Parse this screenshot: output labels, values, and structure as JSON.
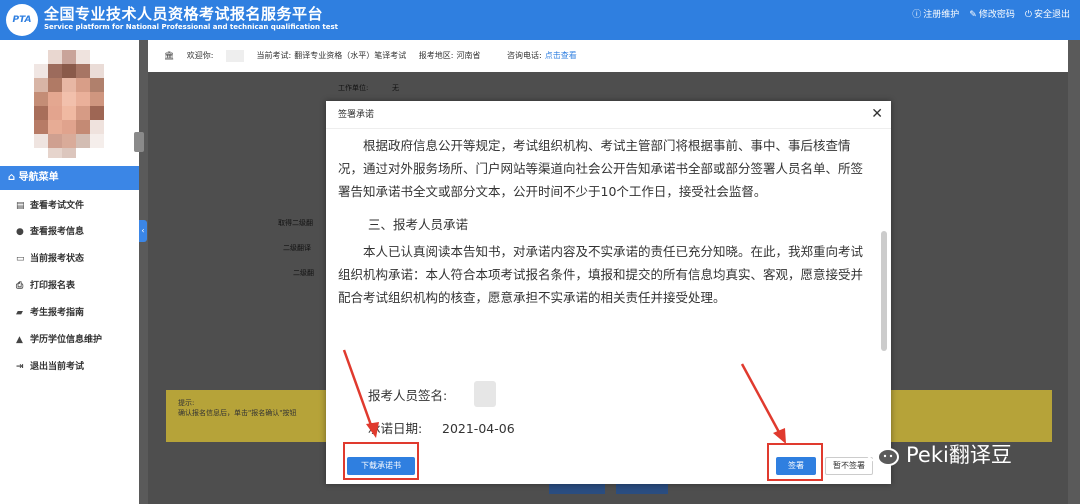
{
  "header": {
    "logo_text": "PTA",
    "title_cn": "全国专业技术人员资格考试报名服务平台",
    "title_en": "Service platform for National Professional and technican qualification test",
    "links": [
      {
        "icon": "info-icon",
        "label": "注册维护"
      },
      {
        "icon": "edit-icon",
        "label": "修改密码"
      },
      {
        "icon": "power-icon",
        "label": "安全退出"
      }
    ]
  },
  "topbar": {
    "welcome": "欢迎你:",
    "current_exam_label": "当前考试:",
    "current_exam": "翻译专业资格（水平）笔译考试",
    "region_label": "报考地区:",
    "region": "河南省",
    "phone_label": "咨询电话:",
    "phone_link": "点击查看"
  },
  "sidebar": {
    "nav_title": "导航菜单",
    "items": [
      {
        "icon": "file-icon",
        "label": "查看考试文件"
      },
      {
        "icon": "info-icon",
        "label": "查看报考信息"
      },
      {
        "icon": "monitor-icon",
        "label": "当前报考状态"
      },
      {
        "icon": "print-icon",
        "label": "打印报名表"
      },
      {
        "icon": "book-icon",
        "label": "考生报考指南"
      },
      {
        "icon": "graduation-cap-icon",
        "label": "学历学位信息维护"
      },
      {
        "icon": "exit-icon",
        "label": "退出当前考试"
      }
    ]
  },
  "background": {
    "work_unit_label": "工作单位:",
    "work_unit_value": "无",
    "row_label_1": "取得二级翻",
    "row_label_2": "二级翻译",
    "row_label_3": "二级翻",
    "notice_title": "提示:",
    "notice_text": "确认报名信息后，单击\"报名确认\"按钮"
  },
  "modal": {
    "title": "签署承诺",
    "paragraph_1": "根据政府信息公开等规定，考试组织机构、考试主管部门将根据事前、事中、事后核查情况，通过对外服务场所、门户网站等渠道向社会公开告知承诺书全部或部分签署人员名单、所签署告知承诺书全文或部分文本，公开时间不少于10个工作日，接受社会监督。",
    "section_title": "三、报考人员承诺",
    "paragraph_2": "本人已认真阅读本告知书，对承诺内容及不实承诺的责任已充分知晓。在此，我郑重向考试组织机构承诺：本人符合本项考试报名条件，填报和提交的所有信息均真实、客观，愿意接受并配合考试组织机构的核查，愿意承担不实承诺的相关责任并接受处理。",
    "sign_label": "报考人员签名:",
    "date_label": "承诺日期:",
    "date_value": "2021-04-06",
    "download_button": "下载承诺书",
    "sign_button": "签署",
    "skip_button": "暂不签署"
  },
  "watermark": {
    "text": "Peki翻译豆"
  },
  "colors": {
    "brand_blue": "#2f7fe0",
    "annotation_red": "#e03a2e",
    "overlay_gray": "#5a5a5a"
  }
}
